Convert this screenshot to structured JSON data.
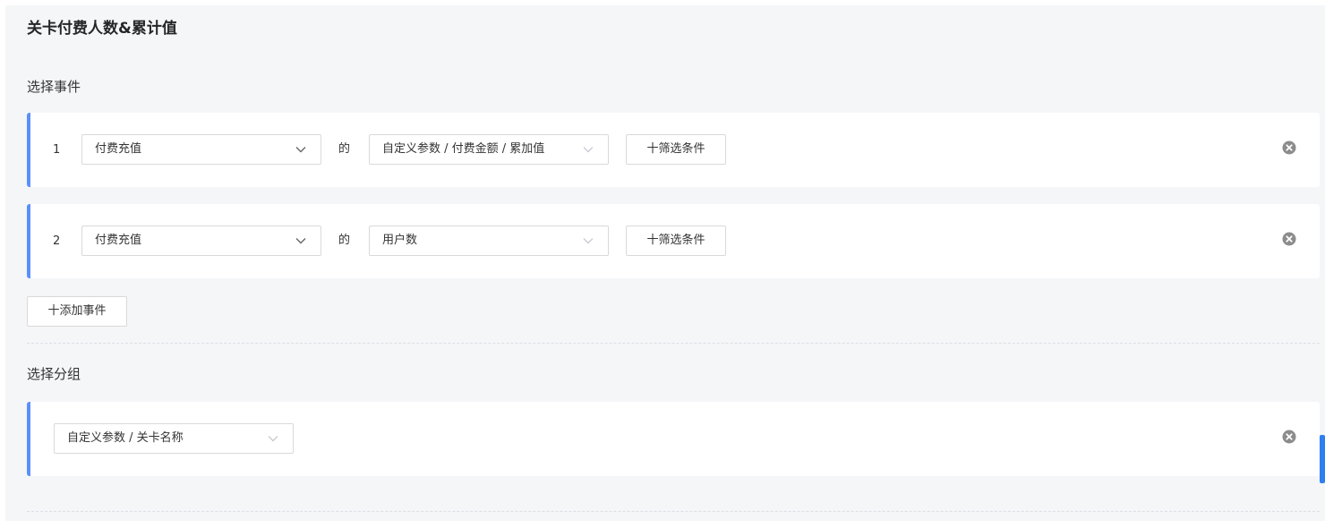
{
  "header": {
    "title": "关卡付费人数&累计值"
  },
  "events_section": {
    "title": "选择事件",
    "events": [
      {
        "index": "1",
        "event": "付费充值",
        "of": "的",
        "metric": "自定义参数 / 付费金额 / 累加值",
        "filter_label": "十筛选条件"
      },
      {
        "index": "2",
        "event": "付费充值",
        "of": "的",
        "metric": "用户数",
        "filter_label": "十筛选条件"
      }
    ],
    "add_event_label": "十添加事件"
  },
  "group_section": {
    "title": "选择分组",
    "group_value": "自定义参数 / 关卡名称"
  },
  "colors": {
    "accent": "#5b8ff9",
    "panel_bg": "#f5f6f8",
    "scroll_thumb": "#2f7ff0"
  },
  "icons": {
    "select_arrow_solid": "chevron-down-icon",
    "select_arrow_light": "chevron-down-light-icon",
    "remove": "close-circle-icon"
  }
}
